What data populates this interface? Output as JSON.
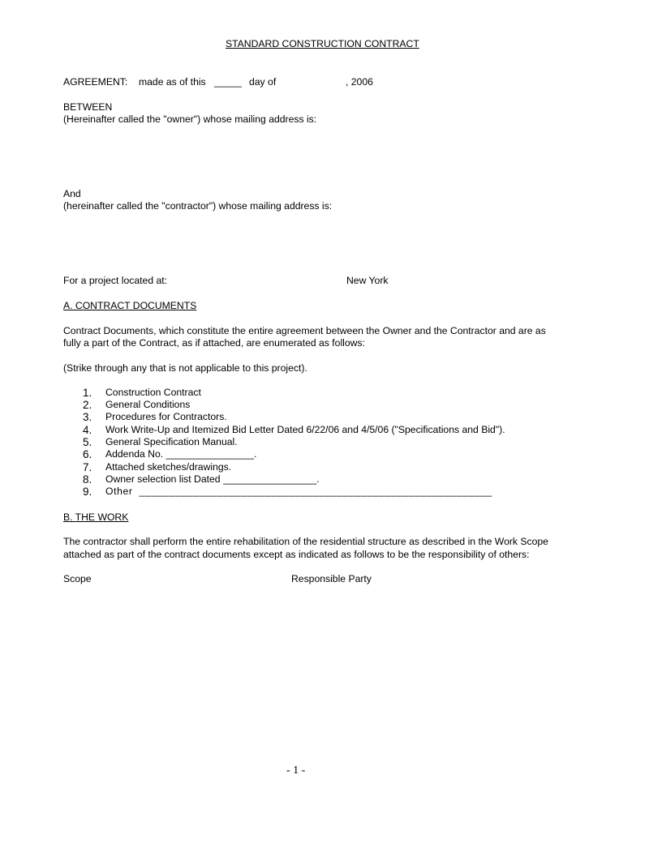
{
  "title": "STANDARD CONSTRUCTION CONTRACT",
  "agreement": {
    "label": "AGREEMENT:",
    "made_as_of": "made as of this",
    "day_blank": "_____",
    "day_of": "day of",
    "year": ", 2006"
  },
  "between": "BETWEEN",
  "owner_line": "(Hereinafter called the \"owner\") whose mailing address is:",
  "and": "And",
  "contractor_line": "(hereinafter called the \"contractor\") whose mailing address is:",
  "project": {
    "label": "For a project located at:",
    "location": "New York"
  },
  "section_a": {
    "heading": "A. CONTRACT DOCUMENTS",
    "para_line1": "Contract Documents, which constitute the entire agreement between the Owner and the Contractor and are as",
    "para_line2": "fully a part of the Contract, as if attached, are enumerated as follows:",
    "strike_note": "(Strike through any that is not applicable to this project).",
    "items": [
      {
        "num": "1.",
        "text": "Construction Contract"
      },
      {
        "num": "2.",
        "text": "General Conditions"
      },
      {
        "num": "3.",
        "text": "Procedures for Contractors."
      },
      {
        "num": "4.",
        "text": "Work Write-Up and Itemized Bid Letter Dated 6/22/06 and 4/5/06 (\"Specifications and Bid\")."
      },
      {
        "num": "5.",
        "text": "General Specification Manual."
      },
      {
        "num": "6.",
        "text": "Addenda No. ________________."
      },
      {
        "num": "7.",
        "text": "Attached sketches/drawings."
      },
      {
        "num": "8.",
        "text": "Owner selection list Dated _________________."
      },
      {
        "num": "9.",
        "text": "Other  ___________________________________________________________"
      }
    ]
  },
  "section_b": {
    "heading": "B. THE WORK",
    "para_line1": "The contractor shall perform the entire rehabilitation of the residential structure as described in the Work Scope",
    "para_line2": "attached as part of the contract documents except as indicated as follows to be the responsibility of others:",
    "col_scope": "Scope",
    "col_party": "Responsible Party"
  },
  "page_number": "- 1 -"
}
